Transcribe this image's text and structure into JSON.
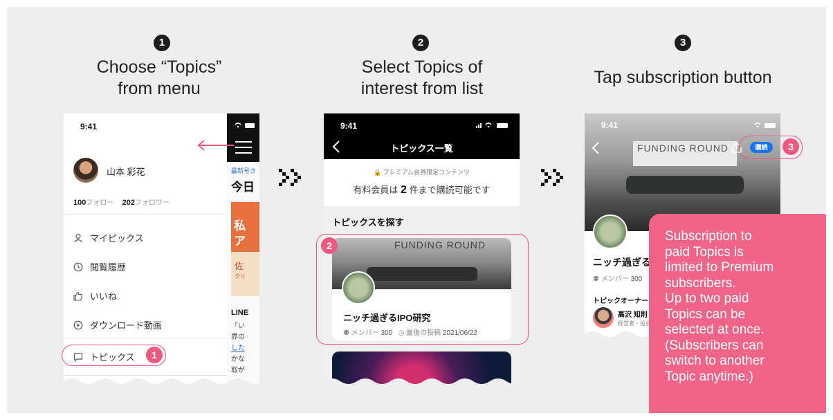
{
  "steps": [
    {
      "number": "1",
      "title_line1": "Choose “Topics”",
      "title_line2": "from menu"
    },
    {
      "number": "2",
      "title_line1": "Select Topics of",
      "title_line2": "interest from list"
    },
    {
      "number": "3",
      "title_line1": "Tap subscription button",
      "title_line2": ""
    }
  ],
  "colors": {
    "accent_pink": "#ec5a80",
    "subscribe_blue": "#1673f5",
    "note_bg": "#f06488"
  },
  "phone1": {
    "time": "9:41",
    "user_name": "山本 彩花",
    "following_count": "100",
    "following_label": "フォロー",
    "follower_count": "202",
    "follower_label": "フォロワー",
    "menu": [
      {
        "label": "マイピックス",
        "icon": "person-icon"
      },
      {
        "label": "閲覧履歴",
        "icon": "clock-icon"
      },
      {
        "label": "いいね",
        "icon": "thumbs-up-icon"
      },
      {
        "label": "ダウンロード動画",
        "icon": "play-circle-icon"
      },
      {
        "label": "トピックス",
        "icon": "chat-icon"
      }
    ],
    "badge": "1",
    "bg_small_label": "最新号さ",
    "bg_heading": "今日",
    "bg_card_line1": "私",
    "bg_card_line2": "ア",
    "bg_card_name": "佐",
    "bg_card_sub": "クリ",
    "bg_line_title": "LINE",
    "bg_line_1": "「い",
    "bg_line_2": "界の",
    "bg_line_3": "した",
    "bg_line_4": "かな",
    "bg_line_5": "取が"
  },
  "phone2": {
    "time": "9:41",
    "header_title": "トピックス一覧",
    "premium_label": "プレミアム会員限定コンテンツ",
    "limit_text_pre": "有料会員は ",
    "limit_count": "2",
    "limit_text_post": " 件まで購読可能です",
    "section_title": "トピックスを探す",
    "card_image_text": "FUNDING ROUND",
    "card_title": "ニッチ過ぎるIPO研究",
    "card_member_label": "メンバー",
    "card_member_count": "300",
    "card_last_post_label": "最後の投稿",
    "card_last_post_date": "2021/06/22",
    "badge": "2"
  },
  "phone3": {
    "time": "9:41",
    "image_text": "FUNDING ROUND",
    "subscribe_label": "購読",
    "badge": "3",
    "title": "ニッチ過ぎるIP",
    "member_label": "メンバー",
    "member_count": "300",
    "owner_section": "トピックオーナー",
    "owner_name": "高沢 知則",
    "owner_role": "経営者・投資"
  },
  "note": {
    "lines": [
      "Subscription to",
      "paid Topics is",
      "limited to Premium",
      "subscribers.",
      "Up to two paid",
      "Topics can be",
      "selected at once.",
      "(Subscribers can",
      "switch to another",
      "Topic anytime.)"
    ]
  }
}
